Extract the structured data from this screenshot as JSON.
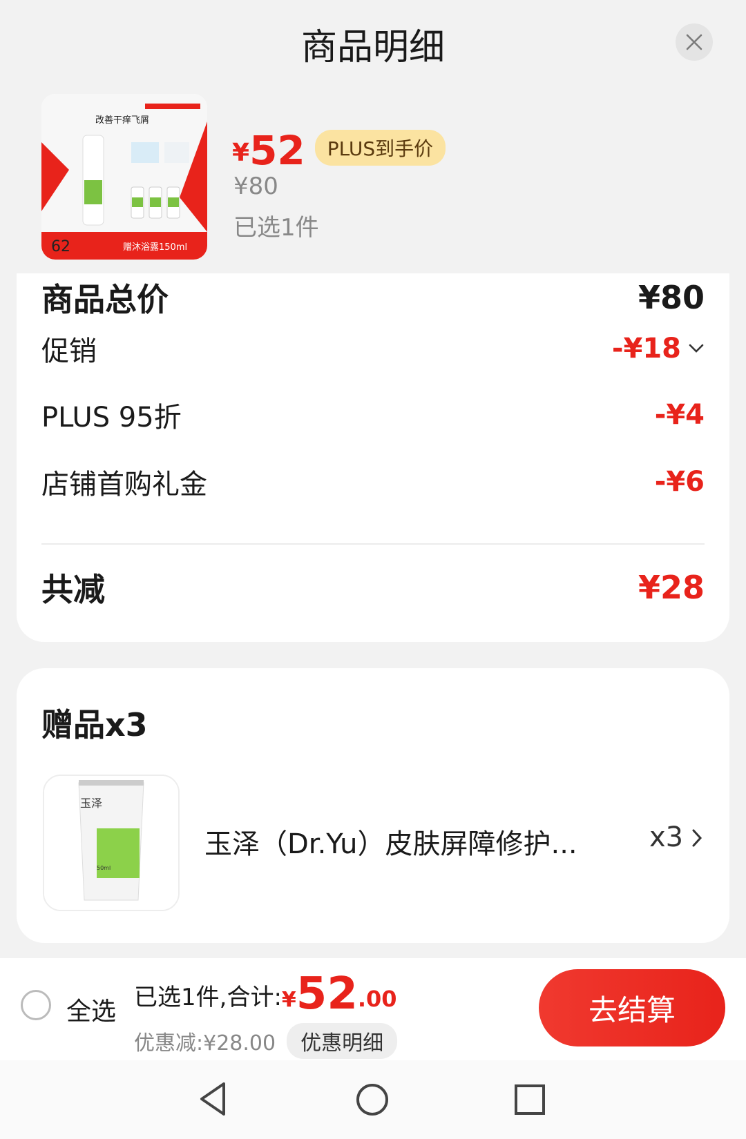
{
  "header": {
    "title": "商品明细"
  },
  "product": {
    "currency": "¥",
    "price": "52",
    "plus_badge": "PLUS到手价",
    "original_price": "¥80",
    "selected": "已选1件",
    "image_caption": "改善干痒飞屑",
    "image_label": "赠沐浴露150ml",
    "image_number": "62"
  },
  "summary": {
    "total_label": "商品总价",
    "total_value": "¥80",
    "items": [
      {
        "label": "促销",
        "value": "-¥18"
      },
      {
        "label": "PLUS 95折",
        "value": "-¥4"
      },
      {
        "label": "店铺首购礼金",
        "value": "-¥6"
      }
    ],
    "saved_label": "共减",
    "saved_value": "¥28"
  },
  "gift": {
    "title": "赠品x3",
    "name": "玉泽（Dr.Yu）皮肤屏障修护...",
    "qty": "x3",
    "tube_brand": "玉泽",
    "tube_volume": "50ml"
  },
  "bottom": {
    "select_all": "全选",
    "total_prefix": "已选1件,合计:",
    "currency": "¥",
    "total_int": "52",
    "total_dec": ".00",
    "discount": "优惠减:¥28.00",
    "detail_button": "优惠明细",
    "checkout": "去结算"
  },
  "colors": {
    "accent_red": "#e8231b",
    "plus_badge_bg": "#fbe3a1",
    "background": "#f2f2f2"
  },
  "icons": [
    "close-icon",
    "chevron-down-icon",
    "chevron-right-icon",
    "nav-back-icon",
    "nav-home-icon",
    "nav-recent-icon"
  ]
}
